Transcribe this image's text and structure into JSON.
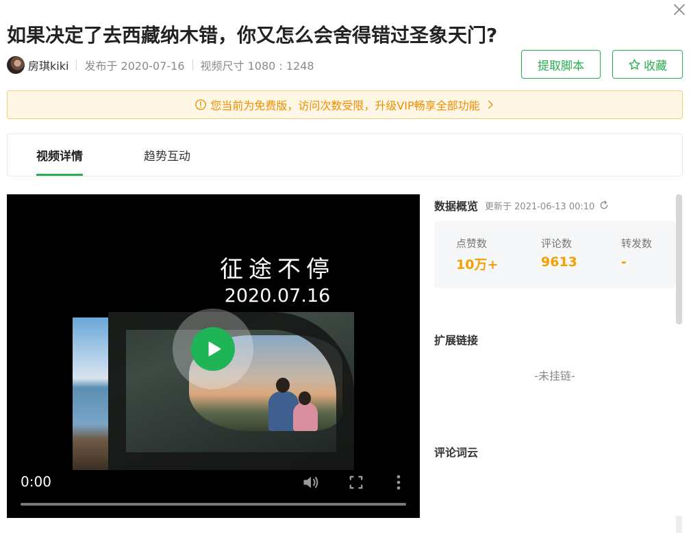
{
  "title": "如果决定了去西藏纳木错，你又怎么会舍得错过圣象天门?",
  "meta": {
    "author": "房琪kiki",
    "published": "发布于 2020-07-16",
    "video_size": "视频尺寸 1080 : 1248"
  },
  "actions": {
    "extract_script": "提取脚本",
    "favorite": "收藏"
  },
  "banner": {
    "text": "您当前为免费版，访问次数受限，升级VIP畅享全部功能"
  },
  "tabs": [
    {
      "label": "视频详情",
      "active": true
    },
    {
      "label": "趋势互动",
      "active": false
    }
  ],
  "video": {
    "overlay_title": "征途不停",
    "overlay_date": "2020.07.16",
    "time": "0:00",
    "progress": 0
  },
  "overview": {
    "title": "数据概览",
    "updated": "更新于 2021-06-13 00:10",
    "stats": [
      {
        "label": "点赞数",
        "value": "10万+"
      },
      {
        "label": "评论数",
        "value": "9613"
      },
      {
        "label": "转发数",
        "value": "-"
      }
    ]
  },
  "extension": {
    "title": "扩展链接",
    "empty": "-未挂链-"
  },
  "word_cloud": {
    "title": "评论词云"
  },
  "colors": {
    "accent": "#27ae4e",
    "play": "#1fb455",
    "warning": "#f08c00",
    "stat_value": "#f5a000"
  },
  "icons": [
    "close-icon",
    "star-icon",
    "info-circle-icon",
    "chevron-right-icon",
    "play-icon",
    "volume-icon",
    "fullscreen-icon",
    "more-vertical-icon",
    "refresh-icon"
  ]
}
